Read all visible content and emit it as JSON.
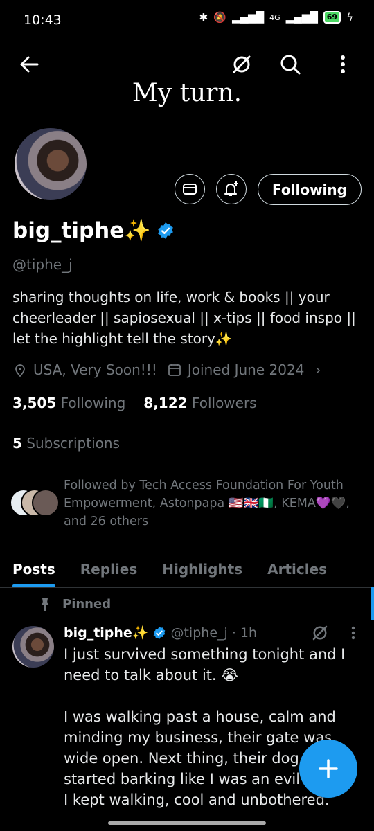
{
  "status_bar": {
    "time": "10:43",
    "battery": "69",
    "network": "4G"
  },
  "header": {
    "back_icon": "arrow-left-icon",
    "grok_icon": "grok-icon",
    "search_icon": "search-icon",
    "more_icon": "more-vertical-icon",
    "banner_text": "My turn."
  },
  "profile": {
    "display_name": "big_tiphe✨",
    "verified": true,
    "handle": "@tiphe_j",
    "bio": "sharing thoughts on life, work & books || your cheerleader || sapiosexual || x-tips || food inspo || let the highlight tell the story✨",
    "location": "USA, Very Soon!!!",
    "joined": "Joined June 2024",
    "following_count": "3,505",
    "following_label": "Following",
    "followers_count": "8,122",
    "followers_label": "Followers",
    "subscriptions_count": "5",
    "subscriptions_label": "Subscriptions",
    "followed_by": "Followed by Tech Access Foundation For Youth Empowerment, Astonpapa 🇺🇸🇬🇧🇳🇬, KEMA💜🖤, and 26 others"
  },
  "actions": {
    "message_icon": "mail-icon",
    "notify_icon": "bell-plus-icon",
    "following_label": "Following"
  },
  "tabs": [
    {
      "label": "Posts",
      "active": true
    },
    {
      "label": "Replies",
      "active": false
    },
    {
      "label": "Highlights",
      "active": false
    },
    {
      "label": "Articles",
      "active": false
    }
  ],
  "pinned_post": {
    "pinned_label": "Pinned",
    "name": "big_tiphe✨",
    "handle_time": "@tiphe_j · 1h",
    "text": "I just survived something tonight and I need to talk about it. 😭\n\nI was walking past a house, calm and minding my business, their gate was wide open. Next thing, their dog started barking like I was an evil spirit. I kept walking, cool and unbothered."
  },
  "colors": {
    "accent": "#1d9bf0",
    "background": "#000000",
    "muted_text": "#71767b"
  }
}
